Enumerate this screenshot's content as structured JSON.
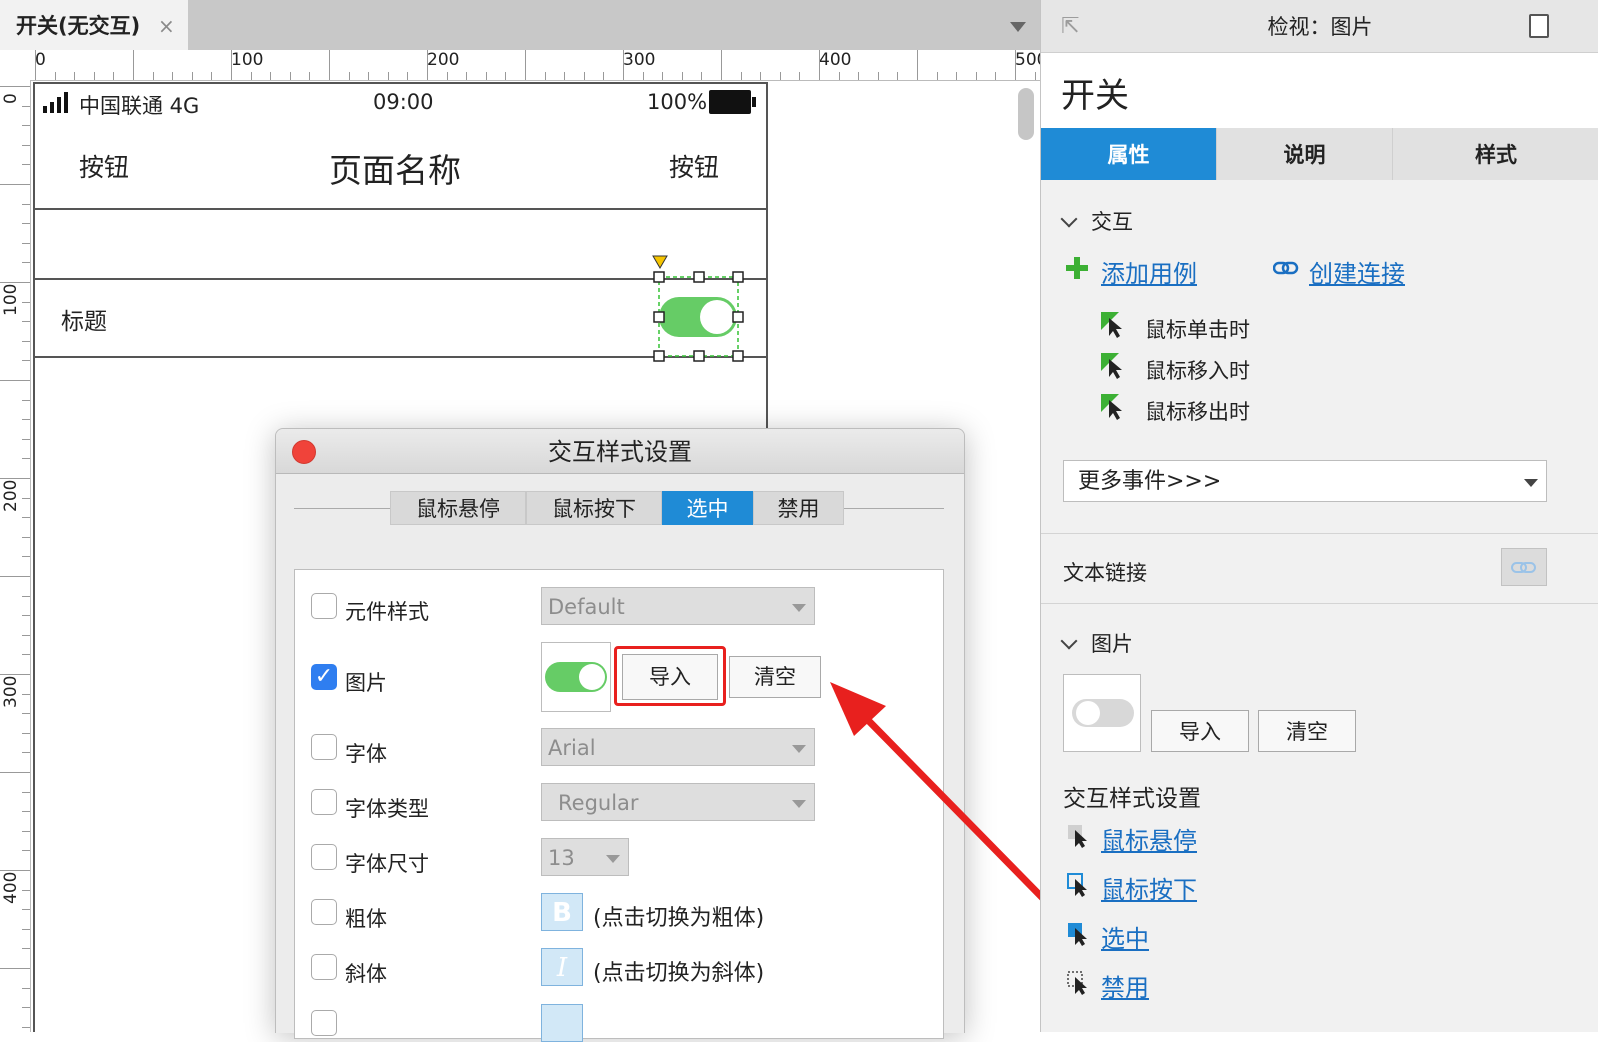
{
  "tabbar": {
    "doc_tab": "开关(无交互)",
    "close_glyph": "×"
  },
  "ruler": {
    "h_labels": [
      "0",
      "100",
      "200",
      "300",
      "400",
      "500"
    ],
    "v_labels": [
      "0",
      "100",
      "200",
      "300",
      "400"
    ]
  },
  "phone": {
    "status": {
      "carrier": "中国联通 4G",
      "time": "09:00",
      "battery": "100%"
    },
    "nav": {
      "left_button": "按钮",
      "title": "页面名称",
      "right_button": "按钮"
    },
    "row_title": "标题"
  },
  "dialog": {
    "title": "交互样式设置",
    "tabs": [
      {
        "label": "鼠标悬停",
        "active": false
      },
      {
        "label": "鼠标按下",
        "active": false
      },
      {
        "label": "选中",
        "active": true
      },
      {
        "label": "禁用",
        "active": false
      }
    ],
    "rows": {
      "widget_style": {
        "label": "元件样式",
        "value": "Default",
        "checked": false
      },
      "image": {
        "label": "图片",
        "checked": true,
        "import_label": "导入",
        "clear_label": "清空"
      },
      "font": {
        "label": "字体",
        "value": "Arial",
        "checked": false
      },
      "font_type": {
        "label": "字体类型",
        "value": "Regular",
        "checked": false
      },
      "font_size": {
        "label": "字体尺寸",
        "value": "13",
        "checked": false
      },
      "bold": {
        "label": "粗体",
        "glyph": "B",
        "hint": "(点击切换为粗体)",
        "checked": false
      },
      "italic": {
        "label": "斜体",
        "glyph": "I",
        "hint": "(点击切换为斜体)",
        "checked": false
      }
    },
    "checkmark": "✓"
  },
  "inspector": {
    "header_title": "检视：图片",
    "widget_name": "开关",
    "tabs": [
      {
        "label": "属性",
        "active": true
      },
      {
        "label": "说明",
        "active": false
      },
      {
        "label": "样式",
        "active": false
      }
    ],
    "interaction": {
      "heading": "交互",
      "add_case": "添加用例",
      "create_link": "创建连接",
      "events": [
        "鼠标单击时",
        "鼠标移入时",
        "鼠标移出时"
      ],
      "more_events": "更多事件>>>"
    },
    "text_link": "文本链接",
    "image": {
      "heading": "图片",
      "import_label": "导入",
      "clear_label": "清空"
    },
    "style_settings": {
      "heading": "交互样式设置",
      "links": [
        "鼠标悬停",
        "鼠标按下",
        "选中",
        "禁用"
      ]
    }
  },
  "colors": {
    "accent": "#1f8bd6",
    "toggle_on": "#66cc66",
    "annotation": "#e8201e",
    "link": "#1a6fc2"
  }
}
